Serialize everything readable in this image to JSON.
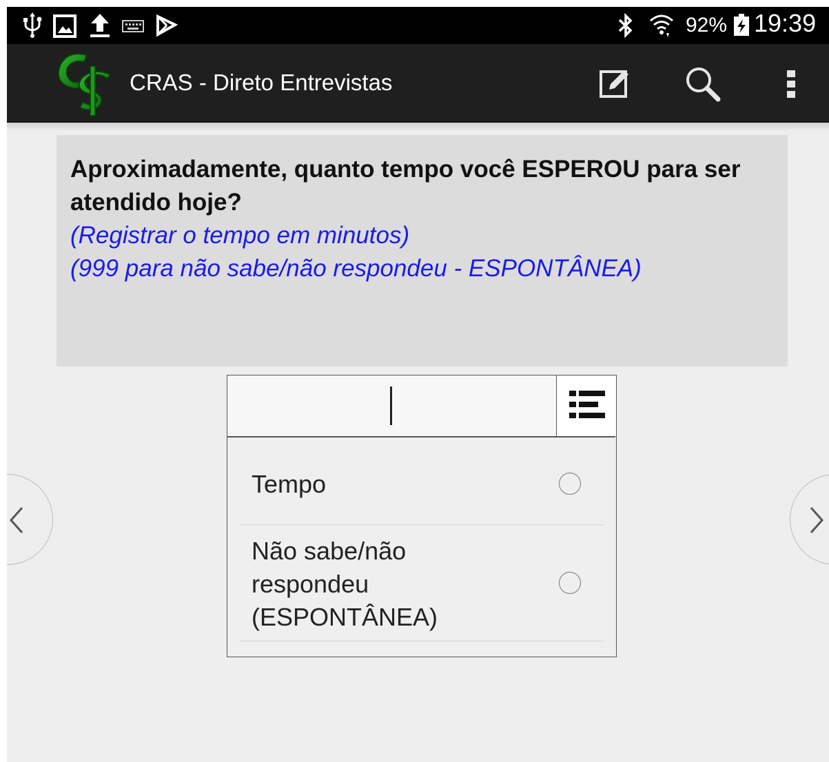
{
  "status_bar": {
    "battery": "92%",
    "time": "19:39",
    "icons": [
      "usb-icon",
      "screenshot-icon",
      "upload-icon",
      "keyboard-icon",
      "store-icon",
      "bluetooth-icon",
      "wifi-icon",
      "battery-charging-icon"
    ]
  },
  "action_bar": {
    "title": "CRAS - Direto Entrevistas",
    "logo": "cs-logo",
    "actions": [
      "edit-icon",
      "search-icon",
      "overflow-menu-icon"
    ]
  },
  "question": {
    "title": "Aproximadamente, quanto tempo você ESPEROU para ser atendido hoje?",
    "hint_line1": "(Registrar o tempo em minutos)",
    "hint_line2": "(999 para não sabe/não respondeu - ESPONTÂNEA)"
  },
  "answer": {
    "input_value": "",
    "options": [
      {
        "lines": [
          "Tempo"
        ],
        "selected": false
      },
      {
        "lines": [
          "Não sabe/não",
          "respondeu",
          "(ESPONTÂNEA)"
        ],
        "selected": false
      }
    ]
  },
  "navigation": {
    "prev": "chevron-left-icon",
    "next": "chevron-right-icon"
  },
  "colors": {
    "status_bar": "#000000",
    "action_bar": "#1f1f1f",
    "question_bg": "#dcdcdc",
    "hint_text": "#1a1aee",
    "logo_green": "#1f8a1f"
  }
}
